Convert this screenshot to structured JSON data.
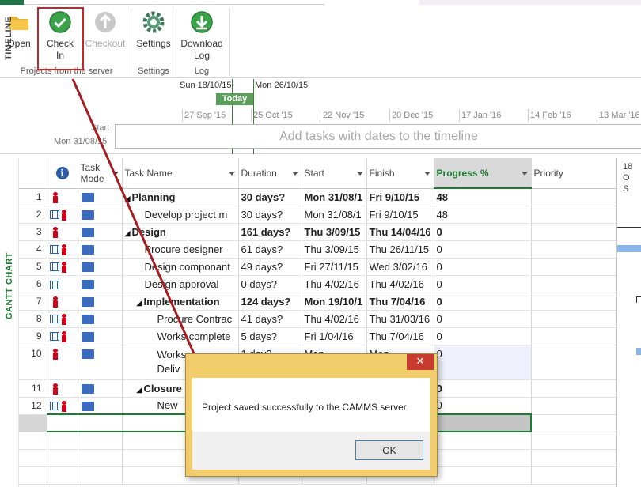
{
  "ribbon": {
    "buttons": {
      "open": "Open",
      "checkin_line1": "Check",
      "checkin_line2": "In",
      "checkout": "Checkout",
      "settings": "Settings",
      "download_line1": "Download",
      "download_line2": "Log"
    },
    "groups": {
      "server": "Projects from the server",
      "settings": "Settings",
      "log": "Log"
    }
  },
  "timeline": {
    "label": "TIMELINE",
    "date_left": "Sun 18/10/15",
    "date_right": "Mon 26/10/15",
    "today": "Today",
    "ticks": [
      "27 Sep '15",
      "25 Oct '15",
      "22 Nov '15",
      "20 Dec '15",
      "17 Jan '16",
      "14 Feb '16",
      "13 Mar '16"
    ],
    "start_label": "Start",
    "start_date": "Mon 31/08/15",
    "placeholder": "Add tasks with dates to the timeline"
  },
  "gantt": {
    "label": "GANTT CHART",
    "columns": {
      "info_icon": "i",
      "mode_line1": "Task",
      "mode_line2": "Mode",
      "task_name": "Task Name",
      "duration": "Duration",
      "start": "Start",
      "finish": "Finish",
      "progress": "Progress %",
      "priority": "Priority"
    },
    "chart_header_line1": "18 O",
    "chart_header_line2": "S",
    "rows": [
      {
        "id": "1",
        "name": "Planning",
        "duration": "30 days?",
        "start": "Mon 31/08/1",
        "finish": "Fri 9/10/15",
        "progress": "48"
      },
      {
        "id": "2",
        "name": "Develop project m",
        "duration": "30 days?",
        "start": "Mon 31/08/1",
        "finish": "Fri 9/10/15",
        "progress": "48"
      },
      {
        "id": "3",
        "name": "Design",
        "duration": "161 days?",
        "start": "Thu 3/09/15",
        "finish": "Thu 14/04/16",
        "progress": "0"
      },
      {
        "id": "4",
        "name": "Procure designer",
        "duration": "61 days?",
        "start": "Thu 3/09/15",
        "finish": "Thu 26/11/15",
        "progress": "0"
      },
      {
        "id": "5",
        "name": "Design componant",
        "duration": "49 days?",
        "start": "Fri 27/11/15",
        "finish": "Wed 3/02/16",
        "progress": "0"
      },
      {
        "id": "6",
        "name": "Design approval",
        "duration": "0 days?",
        "start": "Thu 4/02/16",
        "finish": "Thu 4/02/16",
        "progress": "0"
      },
      {
        "id": "7",
        "name": "Implementation",
        "duration": "124 days?",
        "start": "Mon 19/10/1",
        "finish": "Thu 7/04/16",
        "progress": "0"
      },
      {
        "id": "8",
        "name": "Procure Contrac",
        "duration": "41 days?",
        "start": "Thu 4/02/16",
        "finish": "Thu 31/03/16",
        "progress": "0"
      },
      {
        "id": "9",
        "name": "Works complete",
        "duration": "5 days?",
        "start": "Fri 1/04/16",
        "finish": "Thu 7/04/16",
        "progress": "0"
      },
      {
        "id": "10",
        "name_line1": "Works",
        "name_line2": "Deliv",
        "duration": "1 day?",
        "start": "Mon",
        "finish": "Mon",
        "progress": "0"
      },
      {
        "id": "11",
        "name": "Closure",
        "duration": "",
        "start": "",
        "finish": "",
        "progress": "0"
      },
      {
        "id": "12",
        "name": "New",
        "duration": "",
        "start": "",
        "finish": "",
        "progress": "0"
      }
    ]
  },
  "dialog": {
    "close": "✕",
    "message": "Project saved successfully to the CAMMS server",
    "ok": "OK"
  },
  "colors": {
    "accent_green": "#217346",
    "highlight_red": "#c0282c",
    "dialog_frame": "#f1ce6b"
  }
}
